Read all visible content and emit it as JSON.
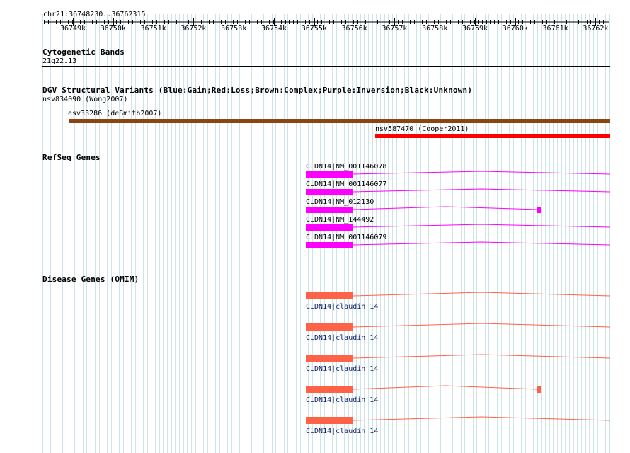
{
  "header": {
    "location": "chr21:36748230..36762315",
    "ticks": [
      "36749k",
      "36750k",
      "36751k",
      "36752k",
      "36753k",
      "36754k",
      "36755k",
      "36756k",
      "36757k",
      "36758k",
      "36759k",
      "36760k",
      "36761k",
      "36762k"
    ]
  },
  "tracks": {
    "cytoband": {
      "title": "Cytogenetic Bands",
      "band": "21q22.13"
    },
    "dgv": {
      "title": "DGV Structural Variants (Blue:Gain;Red:Loss;Brown:Complex;Purple:Inversion;Black:Unknown)",
      "features": [
        {
          "label": "nsv834090 (Wong2007)",
          "color": "#b22222"
        },
        {
          "label": "esv33286 (deSmith2007)",
          "color": "#8b4513"
        },
        {
          "label": "nsv587470 (Cooper2011)",
          "color": "#ff0000"
        }
      ]
    },
    "refseq": {
      "title": "RefSeq Genes",
      "color": "#ff00ff",
      "transcripts": [
        {
          "label": "CLDN14|NM_001146078"
        },
        {
          "label": "CLDN14|NM_001146077"
        },
        {
          "label": "CLDN14|NM_012130"
        },
        {
          "label": "CLDN14|NM_144492"
        },
        {
          "label": "CLDN14|NM_001146079"
        }
      ]
    },
    "omim": {
      "title": "Disease Genes (OMIM)",
      "color": "#ff6347",
      "genes": [
        {
          "label": "CLDN14|claudin 14"
        },
        {
          "label": "CLDN14|claudin 14"
        },
        {
          "label": "CLDN14|claudin 14"
        },
        {
          "label": "CLDN14|claudin 14"
        },
        {
          "label": "CLDN14|claudin 14"
        }
      ]
    }
  }
}
